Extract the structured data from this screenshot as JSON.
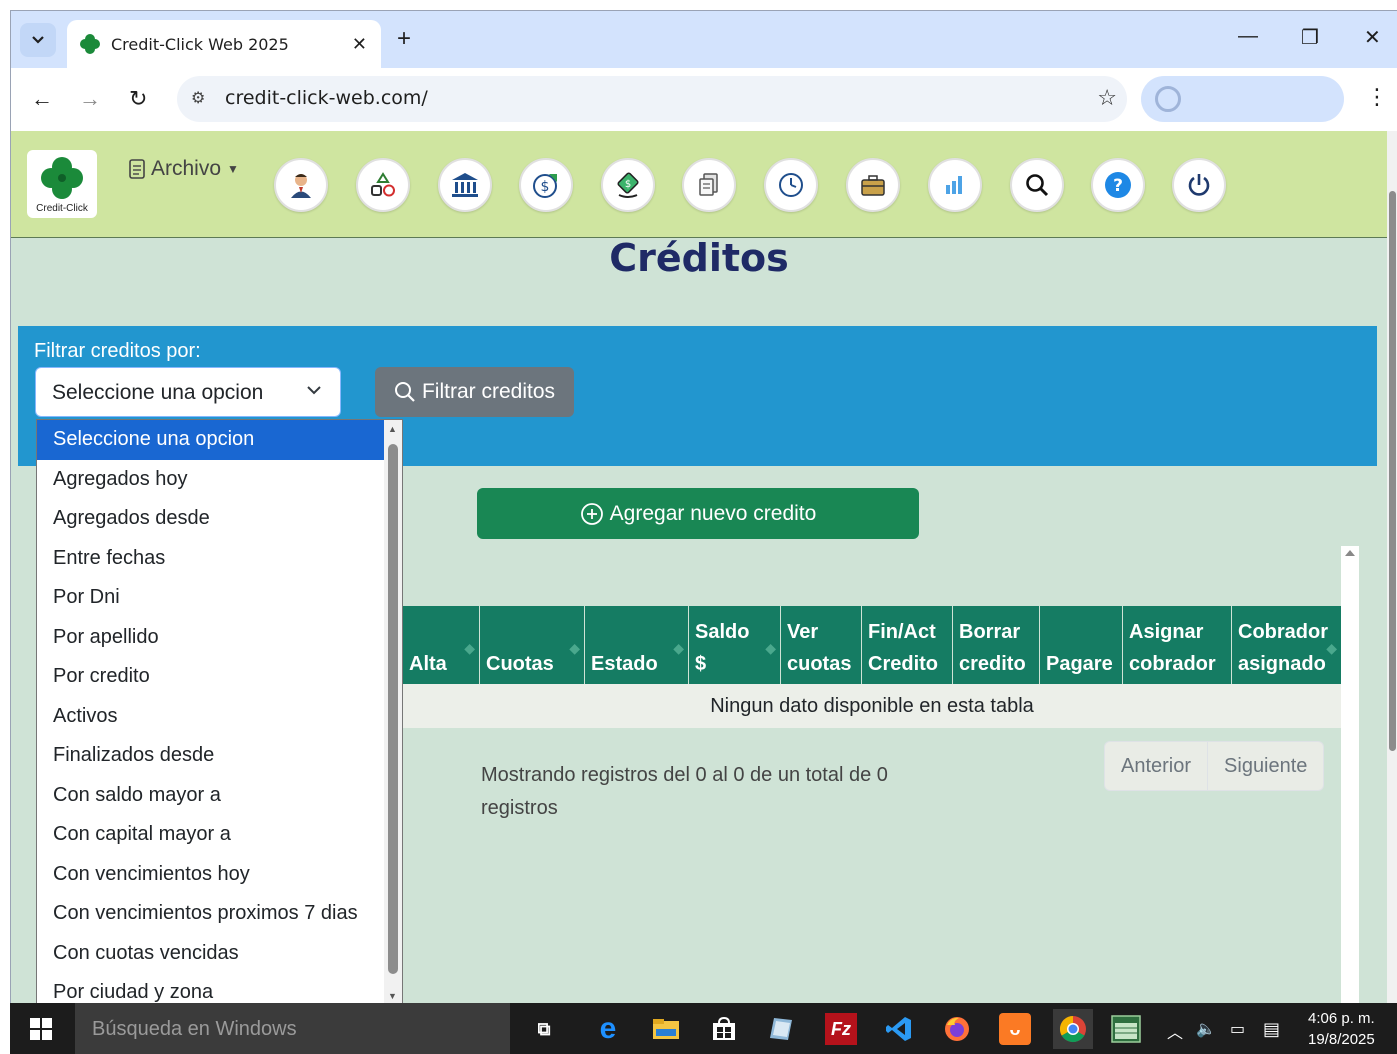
{
  "browser": {
    "tab_title": "Credit-Click Web 2025",
    "url": "credit-click-web.com/"
  },
  "app": {
    "logo_text": "Credit-Click",
    "archivo_label": "Archivo",
    "toolbar_icons": [
      "cliente-icon",
      "grupos-icon",
      "banco-icon",
      "cobros-icon",
      "pagos-icon",
      "documentos-icon",
      "reloj-icon",
      "maletin-icon",
      "estadisticas-icon",
      "buscar-icon",
      "ayuda-icon",
      "salir-icon"
    ]
  },
  "page": {
    "title": "Créditos",
    "filter_label": "Filtrar creditos por:",
    "filter_selected": "Seleccione una opcion",
    "filter_button": "Filtrar creditos",
    "add_button": "Agregar nuevo credito"
  },
  "dropdown_options": [
    "Seleccione una opcion",
    "Agregados hoy",
    "Agregados desde",
    "Entre fechas",
    "Por Dni",
    "Por apellido",
    "Por credito",
    "Activos",
    "Finalizados desde",
    "Con saldo mayor a",
    "Con capital mayor a",
    "Con vencimientos hoy",
    "Con vencimientos proximos 7 dias",
    "Con cuotas vencidas",
    "Por ciudad y zona"
  ],
  "table": {
    "headers": [
      {
        "l1": "",
        "l2": "Alta"
      },
      {
        "l1": "",
        "l2": "Cuotas"
      },
      {
        "l1": "",
        "l2": "Estado"
      },
      {
        "l1": "Saldo",
        "l2": "$"
      },
      {
        "l1": "Ver",
        "l2": "cuotas"
      },
      {
        "l1": "Fin/Act",
        "l2": "Credito"
      },
      {
        "l1": "Borrar",
        "l2": "credito"
      },
      {
        "l1": "",
        "l2": "Pagare"
      },
      {
        "l1": "Asignar",
        "l2": "cobrador"
      },
      {
        "l1": "Cobrador",
        "l2": "asignado"
      }
    ],
    "empty_message": "Ningun dato disponible en esta tabla",
    "info": "Mostrando registros del 0 al 0 de un total de 0 registros",
    "prev": "Anterior",
    "next": "Siguiente"
  },
  "taskbar": {
    "search_placeholder": "Búsqueda en Windows",
    "time": "4:06 p. m.",
    "date": "19/8/2025"
  },
  "colors": {
    "appbar": "#cfe5a0",
    "content_bg": "#cfe3d6",
    "filter_panel": "#2296cf",
    "title": "#1f2a66",
    "add_button": "#198754",
    "table_header": "#157c63",
    "selected_option": "#1967d2"
  }
}
